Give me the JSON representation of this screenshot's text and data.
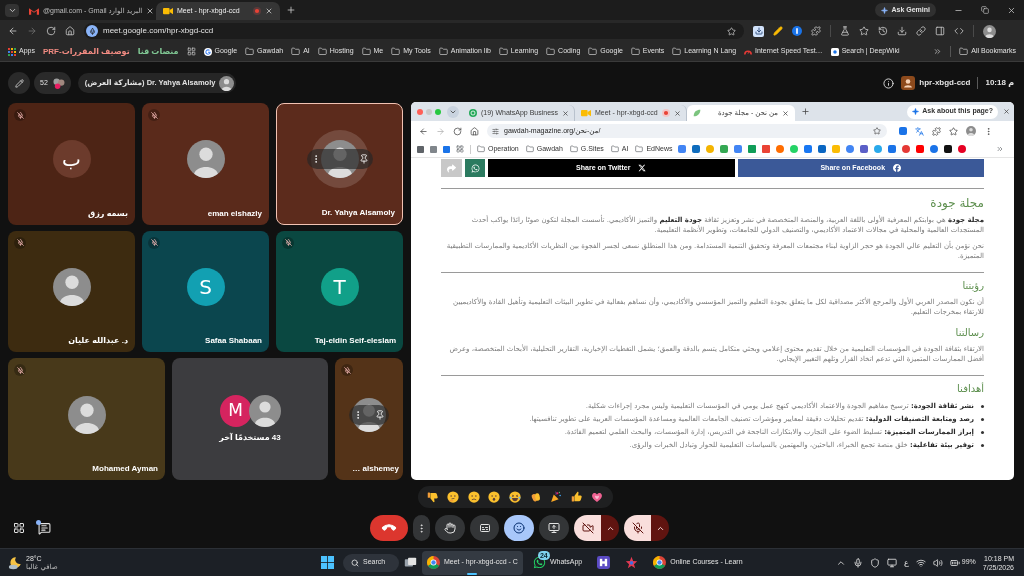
{
  "browser": {
    "tabs": [
      {
        "kind": "meet",
        "title": "Meet - hpr-xbgd-ccd",
        "selected": true,
        "recording": true
      },
      {
        "kind": "gmail",
        "title": "@gmail.com - Gmail البريد الوارد",
        "selected": false,
        "recording": false
      }
    ],
    "gemini_button": "Ask Gemini",
    "url": "meet.google.com/hpr-xbgd-ccd",
    "bookmarks": [
      {
        "kind": "deepwiki",
        "label": "Search | DeepWiki"
      },
      {
        "kind": "speed",
        "label": "Internet Speed Test…"
      },
      {
        "kind": "folder",
        "label": "Learning N Lang"
      },
      {
        "kind": "folder",
        "label": "Events"
      },
      {
        "kind": "folder",
        "label": "Google"
      },
      {
        "kind": "folder",
        "label": "Coding"
      },
      {
        "kind": "folder",
        "label": "Learning"
      },
      {
        "kind": "folder",
        "label": "Animation lib"
      },
      {
        "kind": "folder",
        "label": "My Tools"
      },
      {
        "kind": "folder",
        "label": "Me"
      },
      {
        "kind": "folder",
        "label": "Hosting"
      },
      {
        "kind": "folder",
        "label": "AI"
      },
      {
        "kind": "folder",
        "label": "Gawdah"
      },
      {
        "kind": "google",
        "label": "Google"
      },
      {
        "kind": "grid"
      },
      {
        "kind": "text",
        "label": "منصات قنا",
        "color": "#81c995"
      },
      {
        "kind": "text",
        "label": "PRF-توصيف المقررات",
        "color": "#f28b82"
      },
      {
        "kind": "apps",
        "label": "Apps"
      }
    ],
    "all_bookmarks": "All Bookmarks"
  },
  "meet": {
    "header": {
      "participant_count": "52",
      "presenter": "Dr. Yahya Alsamoly (مشاركة العرض)",
      "meeting_code": "hpr-xbgd-ccd",
      "time": "10:18 م"
    },
    "tiles": [
      {
        "kind": "participant",
        "name": "Dr. Yahya Alsamoly",
        "color": "#5c2b1c",
        "muted": false,
        "speaking": true,
        "highlighted": true,
        "hover_controls": true,
        "avatar": {
          "kind": "photo"
        }
      },
      {
        "kind": "participant",
        "name": "eman elshazly",
        "color": "#5a2a1b",
        "muted": true,
        "speaking": false,
        "highlighted": false,
        "hover_controls": false,
        "avatar": {
          "kind": "photo"
        }
      },
      {
        "kind": "participant",
        "name": "بسمه رزق",
        "color": "#4d2415",
        "muted": true,
        "speaking": false,
        "highlighted": false,
        "hover_controls": false,
        "avatar": {
          "kind": "letter",
          "initial": "ب",
          "color": "#6c3b2c"
        }
      },
      {
        "kind": "participant",
        "name": "Taj-eldin Seif-eleslam",
        "color": "#0a4841",
        "muted": true,
        "speaking": false,
        "highlighted": false,
        "hover_controls": false,
        "avatar": {
          "kind": "letter",
          "initial": "T",
          "color": "#11a089"
        }
      },
      {
        "kind": "participant",
        "name": "Safaa Shabaan",
        "color": "#0b464e",
        "muted": true,
        "speaking": false,
        "highlighted": false,
        "hover_controls": false,
        "avatar": {
          "kind": "letter",
          "initial": "S",
          "color": "#12a0b2"
        }
      },
      {
        "kind": "participant",
        "name": "د. عبدالله عليان",
        "color": "#3d2b10",
        "muted": true,
        "speaking": false,
        "highlighted": false,
        "hover_controls": false,
        "avatar": {
          "kind": "photo"
        }
      },
      {
        "kind": "participant",
        "name": "… alshemey",
        "color": "#543318",
        "muted": true,
        "speaking": false,
        "highlighted": false,
        "hover_controls": true,
        "avatar": {
          "kind": "photo"
        }
      },
      {
        "kind": "others",
        "label": "43 مستخدمًا آخر",
        "color": "#3c3c3f",
        "avatars": [
          {
            "kind": "letter",
            "initial": "M",
            "color": "#d5245f"
          },
          {
            "kind": "photo"
          }
        ]
      },
      {
        "kind": "participant",
        "name": "Mohamed Ayman",
        "color": "#48391a",
        "muted": true,
        "speaking": false,
        "highlighted": false,
        "hover_controls": false,
        "avatar": {
          "kind": "photo"
        }
      }
    ],
    "shared_screen": {
      "tabs": [
        {
          "kind": "site",
          "title": "من نحن - مجلة جودة",
          "selected": true,
          "recording": false
        },
        {
          "kind": "meet",
          "title": "Meet - hpr-xbgd-ccd",
          "selected": false,
          "recording": true
        },
        {
          "kind": "whatsapp",
          "title": "(19) WhatsApp Business",
          "selected": false,
          "recording": false
        }
      ],
      "ask_button": "Ask about this page?",
      "url": "gawdah-magazine.org/من-نحن/",
      "bookmarks": [
        {
          "label": "EdNews"
        },
        {
          "label": "AI"
        },
        {
          "label": "G.Sites"
        },
        {
          "label": "Gawdah"
        },
        {
          "label": "Operation"
        }
      ],
      "share_buttons": [
        {
          "kind": "facebook",
          "label": "Share on Facebook"
        },
        {
          "kind": "twitter",
          "label": "Share on Twitter"
        },
        {
          "kind": "whatsapp"
        },
        {
          "kind": "share"
        }
      ],
      "sections": [
        {
          "kind": "title",
          "divider_before": true,
          "heading": "مجلة جودة",
          "paragraphs": [
            "**مجلة جودة** هي بوابتكم المعرفية الأولى باللغة العربية، والمنصة المتخصصة في نشر وتعزيز ثقافة **جودة التعليم** والتميز الأكاديمي. تأسست المجلة لتكون صوتًا رائدًا يواكب أحدث المستجدات العالمية والمحلية في مجالات الاعتماد الأكاديمي، والتصنيف الدولي للجامعات، وتطوير الأنظمة التعليمية.",
            "نحن نؤمن بأن التعليم عالي الجودة هو حجر الزاوية لبناء مجتمعات المعرفة وتحقيق التنمية المستدامة. ومن هذا المنطلق نسعى لجسر الفجوة بين النظريات الأكاديمية والممارسات التطبيقية المتميزة."
          ]
        },
        {
          "kind": "section",
          "divider_before": true,
          "heading": "رؤيتنا",
          "paragraphs": [
            "أن نكون المصدر العربي الأول والمرجع الأكثر مصداقية لكل ما يتعلق بجودة التعليم والتميز المؤسسي والأكاديمي، وأن نساهم بفعالية في تطوير البيئات التعليمية وتأهيل القادة والأكاديميين للارتقاء بمخرجات التعليم."
          ]
        },
        {
          "kind": "section",
          "divider_before": false,
          "heading": "رسالتنا",
          "paragraphs": [
            "الارتقاء بثقافة الجودة في المؤسسات التعليمية من خلال تقديم محتوى إعلامي وبحثي متكامل يتسم بالدقة والعمق؛ يشمل التغطيات الإخبارية، التقارير التحليلية، الأبحاث المتخصصة، وعرض أفضل الممارسات المتميزة التي تدعم اتخاذ القرار وتلهم التغيير الإيجابي."
          ]
        },
        {
          "kind": "list",
          "divider_before": true,
          "heading": "أهدافنا",
          "bullets": [
            "**نشر ثقافة الجودة:** ترسيخ مفاهيم الجودة والاعتماد الأكاديمي كنهج عمل يومي في المؤسسات التعليمية وليس مجرد إجراءات شكلية.",
            "**رصد ومتابعة التصنيفات الدولية:** تقديم تحليلات دقيقة لمعايير ومؤشرات تصنيف الجامعات العالمية ومساعدة المؤسسات العربية على تطوير تنافسيتها.",
            "**إبراز الممارسات المتميزة:** تسليط الضوء على التجارب والابتكارات الناجحة في التدريس، إدارة المؤسسات، والبحث العلمي لتعميم الفائدة.",
            "**توفير بيئة تفاعلية:** خلق منصة تجمع الخبراء، الباحثين، والمهتمين بالسياسات التعليمية للحوار وتبادل الخبرات والرؤى."
          ]
        }
      ]
    },
    "chat": {
      "unread": true
    },
    "controls": [
      {
        "kind": "mic",
        "on": false
      },
      {
        "kind": "camera",
        "on": false
      },
      {
        "kind": "present",
        "selected": false
      },
      {
        "kind": "reactions",
        "selected": true
      },
      {
        "kind": "captions",
        "selected": false
      },
      {
        "kind": "raise_hand",
        "selected": false
      },
      {
        "kind": "more"
      },
      {
        "kind": "end_call"
      }
    ]
  },
  "taskbar": {
    "weather": {
      "temp": "28°C",
      "condition": "صافي غالبا"
    },
    "search": "Search",
    "apps": [
      {
        "kind": "chrome",
        "label": "Online Courses - Learn",
        "selected": false
      },
      {
        "kind": "star",
        "selected": false
      },
      {
        "kind": "squares",
        "selected": false
      },
      {
        "kind": "whatsapp",
        "label": "WhatsApp",
        "badge": "24",
        "selected": false
      },
      {
        "kind": "chrome",
        "label": "Meet - hpr-xbgd-ccd - C",
        "selected": true
      }
    ],
    "tray": {
      "language": "ع",
      "battery": "99%",
      "time": "10:18 PM",
      "date": "7/25/2026"
    }
  }
}
